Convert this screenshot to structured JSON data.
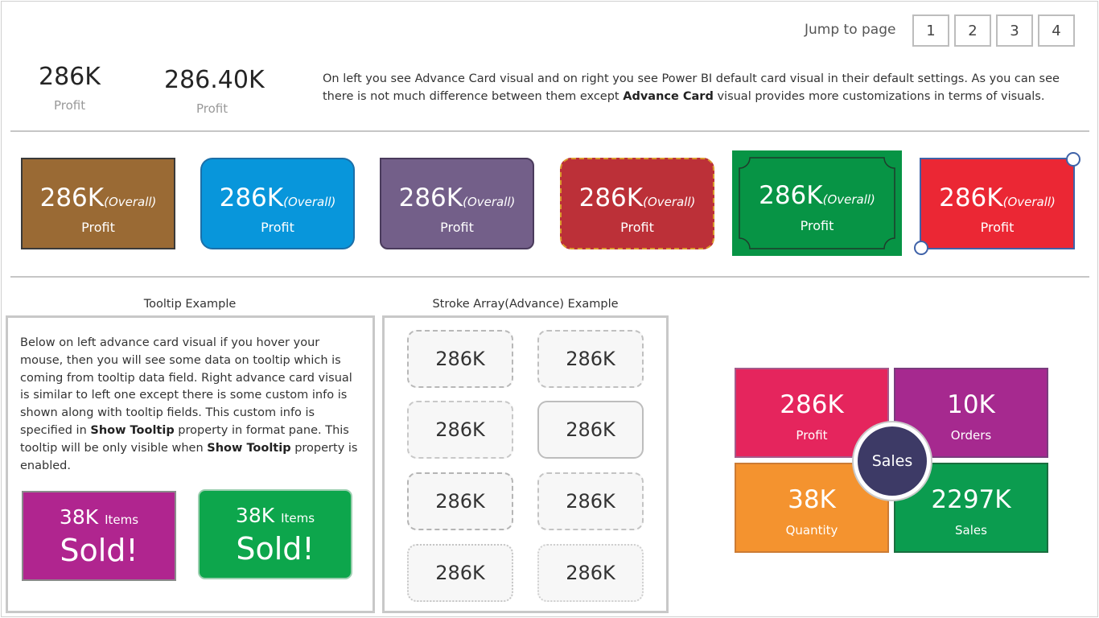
{
  "jump": {
    "label": "Jump to page",
    "pages": [
      "1",
      "2",
      "3",
      "4"
    ]
  },
  "top": {
    "advance_card": {
      "value": "286K",
      "label": "Profit"
    },
    "default_card": {
      "value": "286.40K",
      "label": "Profit"
    },
    "intro": {
      "part1": "On left you see Advance Card visual and on right you see Power BI default card visual in their default settings. As you can see there is not much difference between them except ",
      "bold": "Advance Card",
      "part2": " visual provides more customizations in terms of visuals."
    }
  },
  "color_cards": [
    {
      "value": "286K",
      "suffix": "(Overall)",
      "label": "Profit",
      "color": "#9a6a34"
    },
    {
      "value": "286K",
      "suffix": "(Overall)",
      "label": "Profit",
      "color": "#0896db"
    },
    {
      "value": "286K",
      "suffix": "(Overall)",
      "label": "Profit",
      "color": "#735f89"
    },
    {
      "value": "286K",
      "suffix": "(Overall)",
      "label": "Profit",
      "color": "#bc3038"
    },
    {
      "value": "286K",
      "suffix": "(Overall)",
      "label": "Profit",
      "color": "#079445"
    },
    {
      "value": "286K",
      "suffix": "(Overall)",
      "label": "Profit",
      "color": "#eb2734"
    }
  ],
  "tooltip_section": {
    "title": "Tooltip Example",
    "text": {
      "p1": "Below on left advance card visual if you hover your mouse, then you will see some data on tooltip which is coming from tooltip data field. Right advance card visual is similar to left one except there is some custom info is shown along with tooltip fields. This custom info is specified in ",
      "b1": "Show Tooltip",
      "p2": " property in format pane. This tooltip will be only visible when ",
      "b2": "Show Tooltip",
      "p3": " property is enabled."
    },
    "cards": [
      {
        "value": "38K",
        "unit": "Items",
        "text": "Sold!",
        "color": "#b0258f"
      },
      {
        "value": "38K",
        "unit": "Items",
        "text": "Sold!",
        "color": "#0da64c"
      }
    ]
  },
  "stroke_section": {
    "title": "Stroke Array(Advance) Example",
    "cards": [
      "286K",
      "286K",
      "286K",
      "286K",
      "286K",
      "286K",
      "286K",
      "286K"
    ]
  },
  "quad": {
    "center": "Sales",
    "cells": [
      {
        "value": "286K",
        "label": "Profit",
        "color": "#e5255d"
      },
      {
        "value": "10K",
        "label": "Orders",
        "color": "#a6298f"
      },
      {
        "value": "38K",
        "label": "Quantity",
        "color": "#f4932f"
      },
      {
        "value": "2297K",
        "label": "Sales",
        "color": "#0b9c4f"
      }
    ]
  }
}
